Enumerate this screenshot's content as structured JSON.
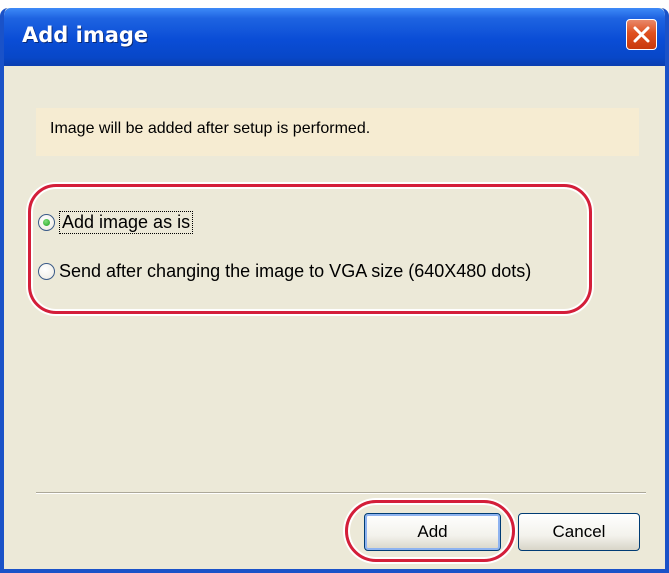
{
  "window": {
    "title": "Add image"
  },
  "banner": {
    "message": "Image will be added after setup is performed."
  },
  "options": [
    {
      "label": "Add image as is",
      "selected": true
    },
    {
      "label": "Send after changing the image to VGA size (640X480 dots)",
      "selected": false
    }
  ],
  "buttons": {
    "add_label": "Add",
    "cancel_label": "Cancel"
  },
  "colors": {
    "titlebar": "#0a4dd6",
    "highlight": "#d41e3a",
    "banner_bg": "#f6ecd2",
    "dialog_bg": "#ece9d8"
  },
  "icons": {
    "close": "close-icon"
  }
}
